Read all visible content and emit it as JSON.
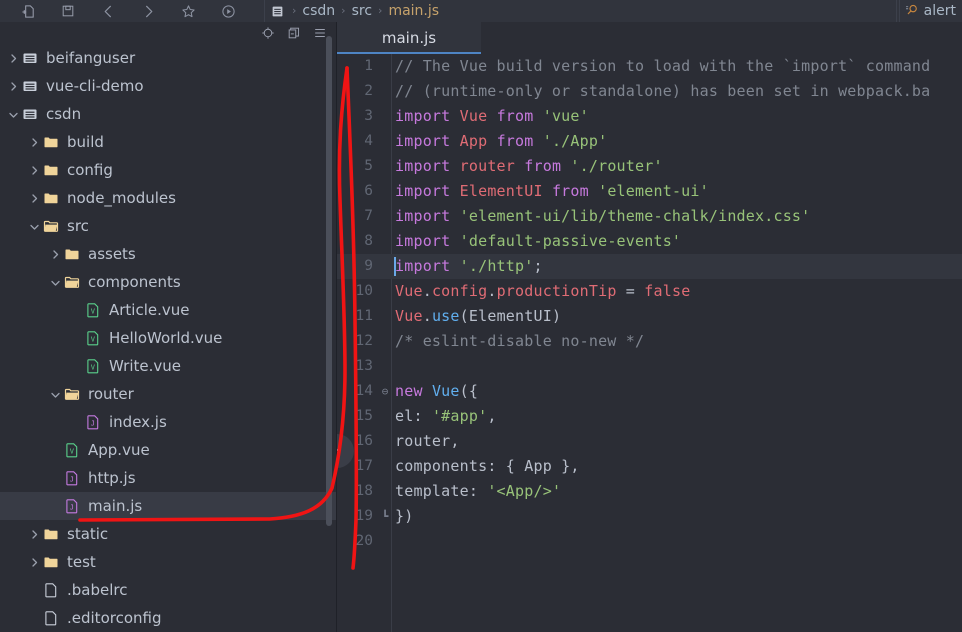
{
  "toolbar": {
    "icons": [
      {
        "name": "new-file-icon",
        "label": "New File"
      },
      {
        "name": "save-icon",
        "label": "Save All"
      },
      {
        "name": "back-arrow-icon",
        "label": "Back"
      },
      {
        "name": "forward-arrow-icon",
        "label": "Forward"
      },
      {
        "name": "bookmark-star-icon",
        "label": "Bookmarks"
      },
      {
        "name": "run-icon",
        "label": "Run"
      }
    ]
  },
  "breadcrumb": {
    "file_icon": "file-icon",
    "separator": "›",
    "items": [
      "csdn",
      "src",
      "main.js"
    ]
  },
  "search": {
    "icon": "search-icon",
    "text": "alert"
  },
  "sidebar": {
    "header_icons": [
      {
        "name": "locate-target-icon"
      },
      {
        "name": "collapse-all-icon"
      },
      {
        "name": "options-menu-icon"
      }
    ],
    "items": [
      {
        "label": "beifanguser",
        "indent": 0,
        "arrow": "right",
        "icon": "module-folder-icon",
        "selected": false
      },
      {
        "label": "vue-cli-demo",
        "indent": 0,
        "arrow": "right",
        "icon": "module-folder-icon",
        "selected": false
      },
      {
        "label": "csdn",
        "indent": 0,
        "arrow": "down",
        "icon": "module-folder-icon",
        "selected": false
      },
      {
        "label": "build",
        "indent": 1,
        "arrow": "right",
        "icon": "folder-icon",
        "selected": false
      },
      {
        "label": "config",
        "indent": 1,
        "arrow": "right",
        "icon": "folder-icon",
        "selected": false
      },
      {
        "label": "node_modules",
        "indent": 1,
        "arrow": "right",
        "icon": "folder-icon",
        "selected": false
      },
      {
        "label": "src",
        "indent": 1,
        "arrow": "down",
        "icon": "folder-open-icon",
        "selected": false
      },
      {
        "label": "assets",
        "indent": 2,
        "arrow": "right",
        "icon": "folder-icon",
        "selected": false
      },
      {
        "label": "components",
        "indent": 2,
        "arrow": "down",
        "icon": "folder-open-icon",
        "selected": false
      },
      {
        "label": "Article.vue",
        "indent": 3,
        "arrow": "none",
        "icon": "vue-file-icon",
        "selected": false
      },
      {
        "label": "HelloWorld.vue",
        "indent": 3,
        "arrow": "none",
        "icon": "vue-file-icon",
        "selected": false
      },
      {
        "label": "Write.vue",
        "indent": 3,
        "arrow": "none",
        "icon": "vue-file-icon",
        "selected": false
      },
      {
        "label": "router",
        "indent": 2,
        "arrow": "down",
        "icon": "folder-open-icon",
        "selected": false
      },
      {
        "label": "index.js",
        "indent": 3,
        "arrow": "none",
        "icon": "js-file-icon",
        "selected": false
      },
      {
        "label": "App.vue",
        "indent": 2,
        "arrow": "none",
        "icon": "vue-file-icon",
        "selected": false
      },
      {
        "label": "http.js",
        "indent": 2,
        "arrow": "none",
        "icon": "js-file-icon",
        "selected": false
      },
      {
        "label": "main.js",
        "indent": 2,
        "arrow": "none",
        "icon": "js-file-icon",
        "selected": true
      },
      {
        "label": "static",
        "indent": 1,
        "arrow": "right",
        "icon": "folder-icon",
        "selected": false
      },
      {
        "label": "test",
        "indent": 1,
        "arrow": "right",
        "icon": "folder-icon",
        "selected": false
      },
      {
        "label": ".babelrc",
        "indent": 1,
        "arrow": "none",
        "icon": "plain-file-icon",
        "selected": false
      },
      {
        "label": ".editorconfig",
        "indent": 1,
        "arrow": "none",
        "icon": "plain-file-icon",
        "selected": false
      }
    ]
  },
  "editor": {
    "tab": {
      "label": "main.js",
      "active": true
    },
    "collapse_button": "‹",
    "cursor_line": 9,
    "highlighted_line": 9,
    "lines": [
      {
        "n": "1",
        "fold": "",
        "tokens": [
          {
            "t": "// The Vue build version to load with the `import` command",
            "c": "t-com"
          }
        ]
      },
      {
        "n": "2",
        "fold": "",
        "tokens": [
          {
            "t": "// (runtime-only or standalone) has been set in webpack.ba",
            "c": "t-com"
          }
        ]
      },
      {
        "n": "3",
        "fold": "",
        "tokens": [
          {
            "t": "import ",
            "c": "t-kw"
          },
          {
            "t": "Vue ",
            "c": "t-cls"
          },
          {
            "t": "from ",
            "c": "t-kw"
          },
          {
            "t": "'vue'",
            "c": "t-str"
          }
        ]
      },
      {
        "n": "4",
        "fold": "",
        "tokens": [
          {
            "t": "import ",
            "c": "t-kw"
          },
          {
            "t": "App ",
            "c": "t-cls"
          },
          {
            "t": "from ",
            "c": "t-kw"
          },
          {
            "t": "'./App'",
            "c": "t-str"
          }
        ]
      },
      {
        "n": "5",
        "fold": "",
        "tokens": [
          {
            "t": "import ",
            "c": "t-kw"
          },
          {
            "t": "router ",
            "c": "t-cls"
          },
          {
            "t": "from ",
            "c": "t-kw"
          },
          {
            "t": "'./router'",
            "c": "t-str"
          }
        ]
      },
      {
        "n": "6",
        "fold": "",
        "tokens": [
          {
            "t": "import ",
            "c": "t-kw"
          },
          {
            "t": "ElementUI ",
            "c": "t-cls"
          },
          {
            "t": "from ",
            "c": "t-kw"
          },
          {
            "t": "'element-ui'",
            "c": "t-str"
          }
        ]
      },
      {
        "n": "7",
        "fold": "",
        "tokens": [
          {
            "t": "import ",
            "c": "t-kw"
          },
          {
            "t": "'element-ui/lib/theme-chalk/index.css'",
            "c": "t-str"
          }
        ]
      },
      {
        "n": "8",
        "fold": "",
        "tokens": [
          {
            "t": "import ",
            "c": "t-kw"
          },
          {
            "t": "'default-passive-events'",
            "c": "t-str"
          }
        ]
      },
      {
        "n": "9",
        "fold": "",
        "tokens": [
          {
            "t": "import ",
            "c": "t-kw"
          },
          {
            "t": "'./http'",
            "c": "t-str"
          },
          {
            "t": ";",
            "c": "t-pun"
          }
        ]
      },
      {
        "n": "10",
        "fold": "",
        "tokens": [
          {
            "t": "Vue",
            "c": "t-cls"
          },
          {
            "t": ".",
            "c": "t-pun"
          },
          {
            "t": "config",
            "c": "t-cls"
          },
          {
            "t": ".",
            "c": "t-pun"
          },
          {
            "t": "productionTip ",
            "c": "t-cls"
          },
          {
            "t": "= ",
            "c": "t-pun"
          },
          {
            "t": "false",
            "c": "t-cls"
          }
        ]
      },
      {
        "n": "11",
        "fold": "",
        "tokens": [
          {
            "t": "Vue",
            "c": "t-cls"
          },
          {
            "t": ".",
            "c": "t-pun"
          },
          {
            "t": "use",
            "c": "t-fn"
          },
          {
            "t": "(",
            "c": "t-pun"
          },
          {
            "t": "ElementUI",
            "c": "t-id"
          },
          {
            "t": ")",
            "c": "t-pun"
          }
        ]
      },
      {
        "n": "12",
        "fold": "",
        "tokens": [
          {
            "t": "/* eslint-disable no-new */",
            "c": "t-com"
          }
        ]
      },
      {
        "n": "13",
        "fold": "",
        "tokens": []
      },
      {
        "n": "14",
        "fold": "⊖",
        "tokens": [
          {
            "t": "new ",
            "c": "t-kw"
          },
          {
            "t": "Vue",
            "c": "t-fn"
          },
          {
            "t": "({",
            "c": "t-pun"
          }
        ]
      },
      {
        "n": "15",
        "fold": "",
        "tokens": [
          {
            "t": "  el",
            "c": "t-id"
          },
          {
            "t": ": ",
            "c": "t-pun"
          },
          {
            "t": "'#app'",
            "c": "t-str"
          },
          {
            "t": ",",
            "c": "t-pun"
          }
        ]
      },
      {
        "n": "16",
        "fold": "",
        "tokens": [
          {
            "t": "  router",
            "c": "t-id"
          },
          {
            "t": ",",
            "c": "t-pun"
          }
        ]
      },
      {
        "n": "17",
        "fold": "",
        "tokens": [
          {
            "t": "  components",
            "c": "t-id"
          },
          {
            "t": ": { ",
            "c": "t-pun"
          },
          {
            "t": "App",
            "c": "t-id"
          },
          {
            "t": " },",
            "c": "t-pun"
          }
        ]
      },
      {
        "n": "18",
        "fold": "",
        "tokens": [
          {
            "t": "  template",
            "c": "t-id"
          },
          {
            "t": ": ",
            "c": "t-pun"
          },
          {
            "t": "'<App/>'",
            "c": "t-str"
          }
        ]
      },
      {
        "n": "19",
        "fold": "┗",
        "tokens": [
          {
            "t": "})",
            "c": "t-pun"
          }
        ]
      },
      {
        "n": "20",
        "fold": "",
        "tokens": []
      }
    ]
  },
  "annotation": {
    "color": "#f01414",
    "shape": "hand-drawn-arrow-from-main-js-to-code"
  },
  "colors": {
    "background": "#2b2d35",
    "panel": "#31343d",
    "selection": "#383b45",
    "accent": "#4e84c4",
    "annotation": "#f01414"
  }
}
